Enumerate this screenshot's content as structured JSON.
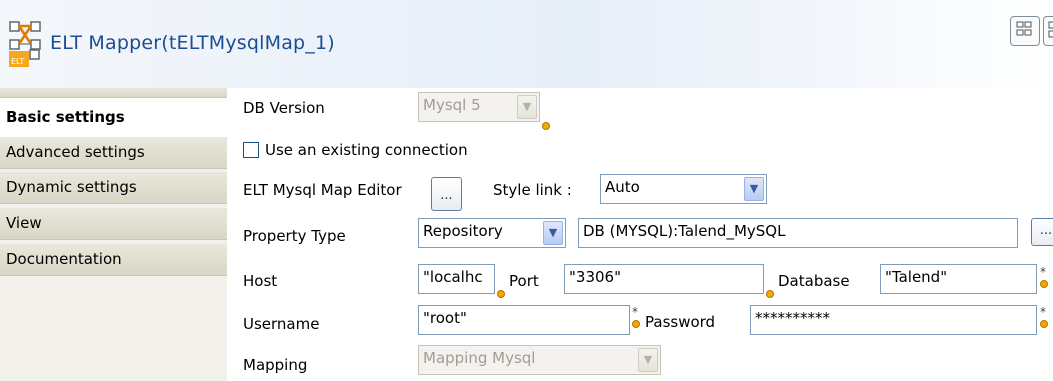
{
  "header": {
    "title": "ELT Mapper(tELTMysqlMap_1)",
    "title_color": "#1a4d94",
    "icon": "elt-mapper-icon",
    "icon_label": "ELT"
  },
  "tabs": [
    {
      "label": "Basic settings",
      "active": true
    },
    {
      "label": "Advanced settings",
      "active": false
    },
    {
      "label": "Dynamic settings",
      "active": false
    },
    {
      "label": "View",
      "active": false
    },
    {
      "label": "Documentation",
      "active": false
    }
  ],
  "form": {
    "db_version": {
      "label": "DB Version",
      "value": "Mysql 5"
    },
    "use_existing": {
      "label": "Use an existing connection",
      "checked": false
    },
    "map_editor": {
      "label": "ELT Mysql Map Editor",
      "button": "..."
    },
    "style_link": {
      "label": "Style link :",
      "value": "Auto"
    },
    "property_type": {
      "label": "Property Type",
      "value": "Repository",
      "repo_value": "DB (MYSQL):Talend_MySQL",
      "button": "..."
    },
    "host": {
      "label": "Host",
      "value": "\"localhc"
    },
    "port": {
      "label": "Port",
      "value": "\"3306\""
    },
    "database": {
      "label": "Database",
      "value": "\"Talend\""
    },
    "username": {
      "label": "Username",
      "value": "\"root\""
    },
    "password": {
      "label": "Password",
      "value": "**********"
    },
    "mapping": {
      "label": "Mapping",
      "value": "Mapping Mysql"
    }
  }
}
